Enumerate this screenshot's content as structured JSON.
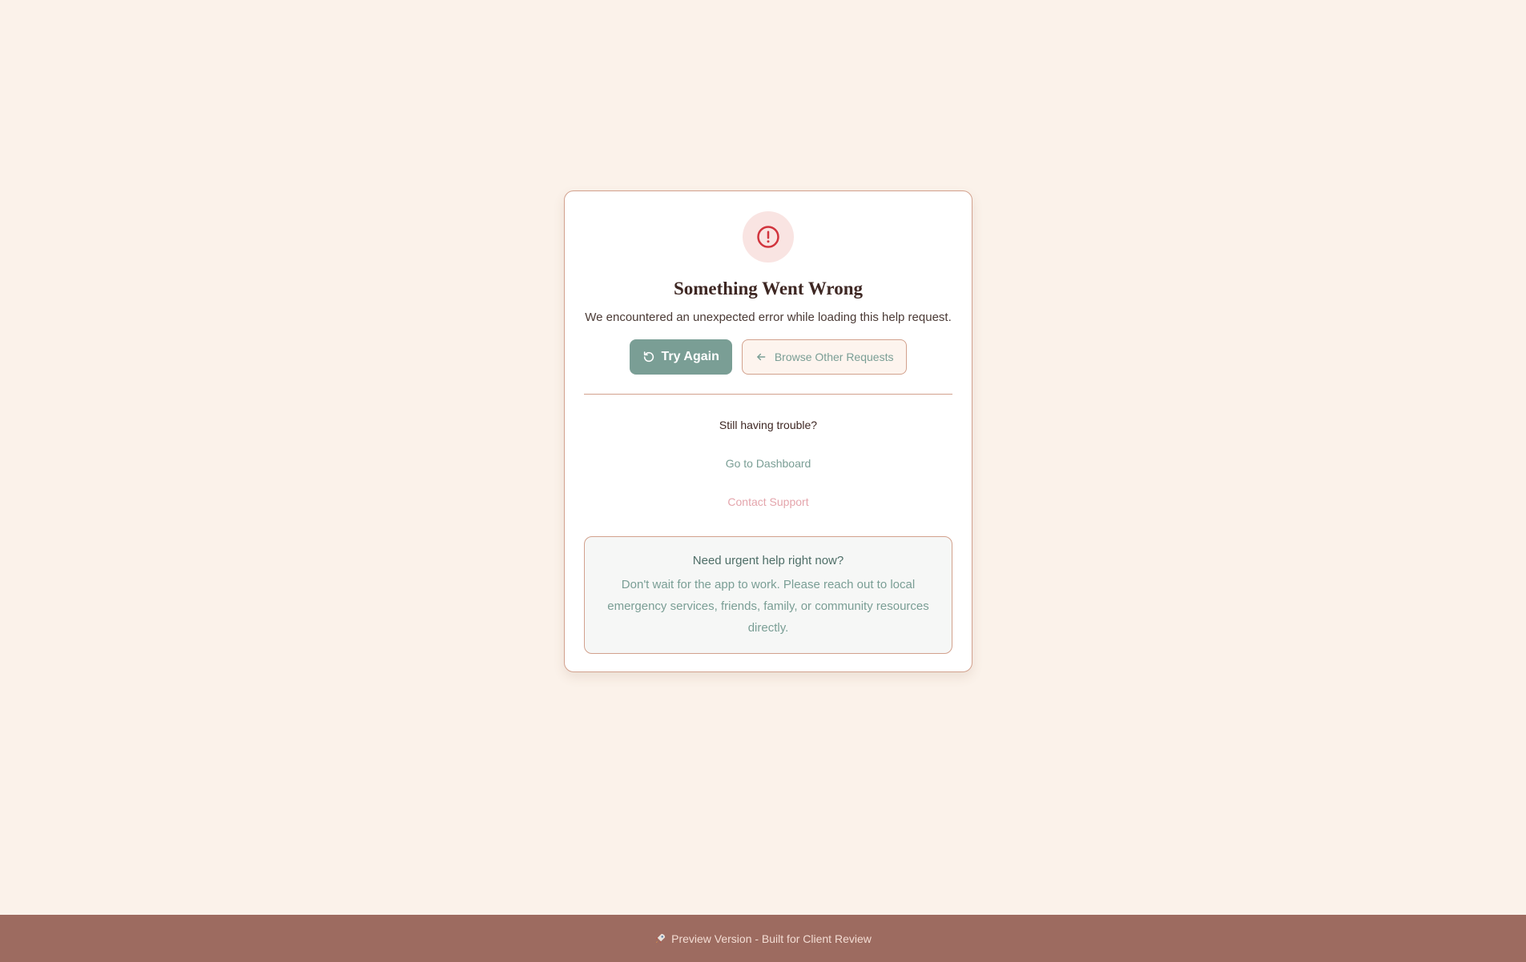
{
  "error_card": {
    "icon": "exclamation-circle-icon",
    "title": "Something Went Wrong",
    "message": "We encountered an unexpected error while loading this help request.",
    "try_again_label": "Try Again",
    "try_again_icon": "refresh-icon",
    "browse_label": "Browse Other Requests",
    "browse_icon": "arrow-left-icon",
    "trouble_text": "Still having trouble?",
    "dashboard_link": "Go to Dashboard",
    "support_link": "Contact Support",
    "urgent": {
      "title": "Need urgent help right now?",
      "text": "Don't wait for the app to work. Please reach out to local emergency services, friends, family, or community resources directly."
    }
  },
  "footer": {
    "icon": "rocket-icon",
    "text": "Preview Version - Built for Client Review"
  },
  "colors": {
    "background": "#fbf2ea",
    "accent": "#7a9e95",
    "error": "#d1343d",
    "border": "#d2a18d",
    "footer": "#9d6b60"
  }
}
